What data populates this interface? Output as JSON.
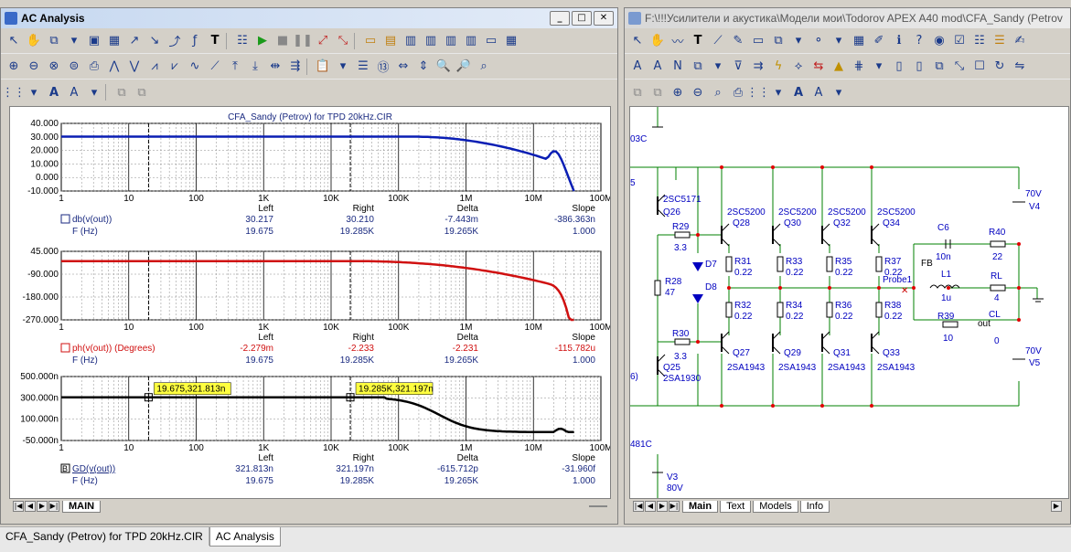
{
  "left_window": {
    "title": "AC Analysis",
    "plot_title": "CFA_Sandy (Petrov) for TPD 20kHz.CIR",
    "tab": "MAIN",
    "plots": [
      {
        "y_ticks": [
          "40.000",
          "30.000",
          "20.000",
          "10.000",
          "0.000",
          "-10.000"
        ],
        "x_ticks": [
          "1",
          "10",
          "100",
          "1K",
          "10K",
          "100K",
          "1M",
          "10M",
          "100M"
        ],
        "hdr": {
          "left": "Left",
          "right": "Right",
          "delta": "Delta",
          "slope": "Slope"
        },
        "row1": {
          "label": "db(v(out))",
          "left": "30.217",
          "right": "30.210",
          "delta": "-7.443m",
          "slope": "-386.363n"
        },
        "row2": {
          "label": "F (Hz)",
          "left": "19.675",
          "right": "19.285K",
          "delta": "19.265K",
          "slope": "1.000"
        }
      },
      {
        "y_ticks": [
          "45.000",
          "-90.000",
          "-180.000",
          "-270.000"
        ],
        "x_ticks": [
          "1",
          "10",
          "100",
          "1K",
          "10K",
          "100K",
          "1M",
          "10M",
          "100M"
        ],
        "hdr": {
          "left": "Left",
          "right": "Right",
          "delta": "Delta",
          "slope": "Slope"
        },
        "row1": {
          "label": "ph(v(out)) (Degrees)",
          "left": "-2.279m",
          "right": "-2.233",
          "delta": "-2.231",
          "slope": "-115.782u"
        },
        "row2": {
          "label": "F (Hz)",
          "left": "19.675",
          "right": "19.285K",
          "delta": "19.265K",
          "slope": "1.000"
        }
      },
      {
        "y_ticks": [
          "500.000n",
          "300.000n",
          "100.000n",
          "-50.000n"
        ],
        "x_ticks": [
          "1",
          "10",
          "100",
          "1K",
          "10K",
          "100K",
          "1M",
          "10M",
          "100M"
        ],
        "hdr": {
          "left": "Left",
          "right": "Right",
          "delta": "Delta",
          "slope": "Slope"
        },
        "row1": {
          "label": "GD(v(out))",
          "left": "321.813n",
          "right": "321.197n",
          "delta": "-615.712p",
          "slope": "-31.960f"
        },
        "row2": {
          "label": "F (Hz)",
          "left": "19.675",
          "right": "19.285K",
          "delta": "19.265K",
          "slope": "1.000"
        },
        "cursor_labels": [
          "19.675,321.813n",
          "19.285K,321.197n"
        ],
        "row1_prefix": "B"
      }
    ]
  },
  "right_window": {
    "title": "F:\\!!!Усилители и акустика\\Модели мои\\Todorov APEX A40 mod\\CFA_Sandy (Petrov",
    "tabs": [
      "Main",
      "Text",
      "Models",
      "Info"
    ],
    "labels": {
      "q26": "Q26",
      "q26p": "2SC5171",
      "q25": "Q25",
      "q25p": "2SA1930",
      "r29": "R29",
      "r29v": "3.3",
      "r30": "R30",
      "r30v": "3.3",
      "r28": "R28",
      "r28v": "47",
      "d7": "D7",
      "d8": "D8",
      "q28p": "2SC5200",
      "q28": "Q28",
      "q30p": "2SC5200",
      "q30": "Q30",
      "q32p": "2SC5200",
      "q32": "Q32",
      "q34p": "2SC5200",
      "q34": "Q34",
      "r31": "R31",
      "r31v": "0.22",
      "r33": "R33",
      "r33v": "0.22",
      "r35": "R35",
      "r35v": "0.22",
      "r37": "R37",
      "r37v": "0.22",
      "r32": "R32",
      "r32v": "0.22",
      "r34": "R34",
      "r34v": "0.22",
      "r36": "R36",
      "r36v": "0.22",
      "r38": "R38",
      "r38v": "0.22",
      "q27": "Q27",
      "q29": "Q29",
      "q31": "Q31",
      "q33": "Q33",
      "q27p": "2SA1943",
      "q29p": "2SA1943",
      "q31p": "2SA1943",
      "q33p": "2SA1943",
      "c6": "C6",
      "c6v": "10n",
      "r40": "R40",
      "r40v": "22",
      "l1": "L1",
      "l1v": "1u",
      "rl": "RL",
      "rlv": "4",
      "r39": "R39",
      "r39v": "10",
      "cl": "CL",
      "clv": "0",
      "fb": "FB",
      "probe": "Probe1",
      "out": "out",
      "v4v": "70V",
      "v4": "V4",
      "v5v": "70V",
      "v5": "V5",
      "v3": "V3",
      "v3v": "80V",
      "e1": "03C",
      "e2": "5",
      "e3": "6)",
      "e4": "481C"
    }
  },
  "taskbar": [
    "CFA_Sandy (Petrov) for TPD 20kHz.CIR",
    "AC Analysis"
  ],
  "colors": {
    "trace1": "#0a1eb4",
    "trace2": "#d01010",
    "trace3": "#000000",
    "cursor_label_bg": "#ffff40",
    "schematic_wire": "#008000",
    "schematic_node": "#e00000",
    "schematic_part": "#0000c0"
  }
}
